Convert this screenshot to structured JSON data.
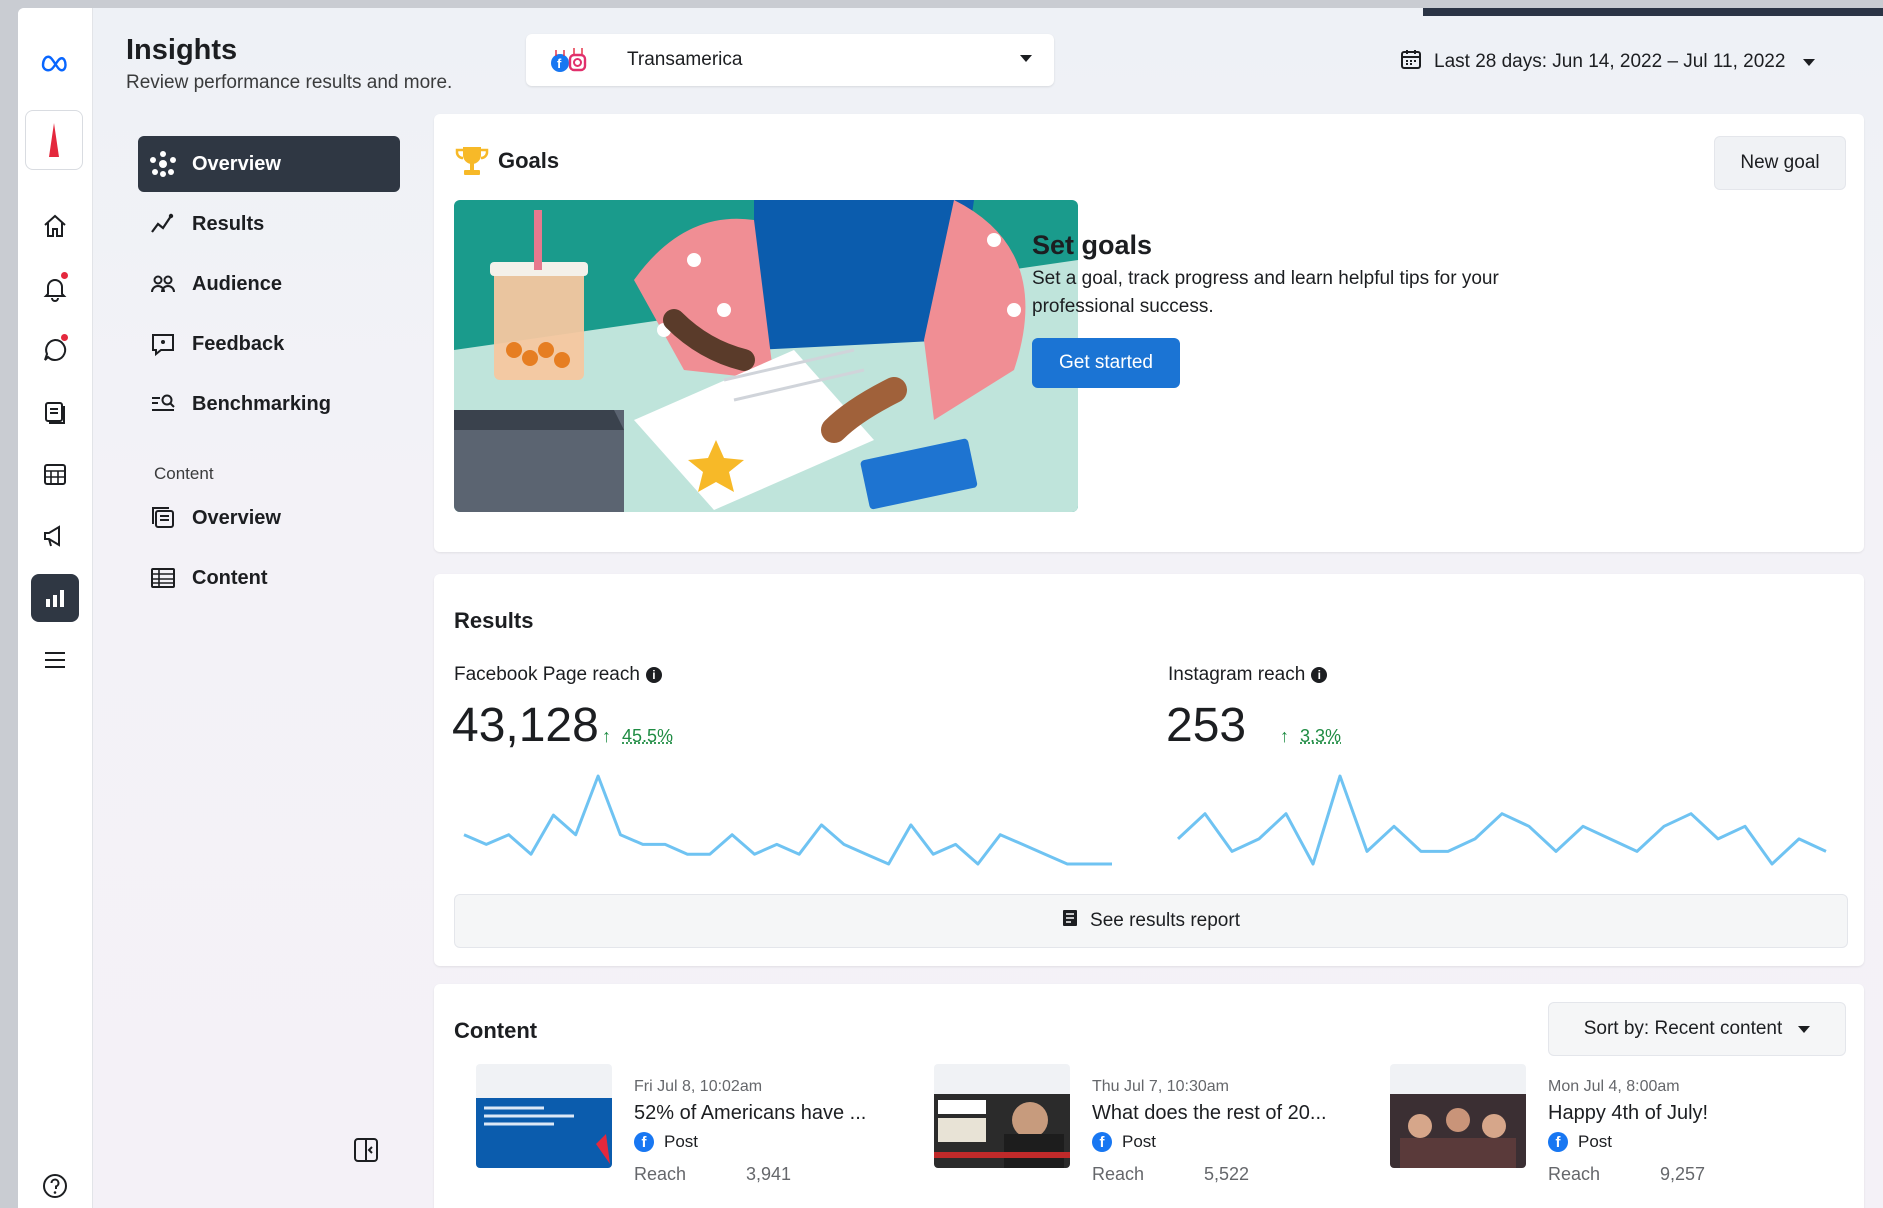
{
  "header": {
    "title": "Insights",
    "subtitle": "Review performance results and more.",
    "account_name": "Transamerica",
    "date_range": "Last 28 days: Jun 14, 2022 – Jul 11, 2022"
  },
  "nav": {
    "items": [
      {
        "label": "Overview",
        "icon": "overview-icon",
        "active": true
      },
      {
        "label": "Results",
        "icon": "results-icon"
      },
      {
        "label": "Audience",
        "icon": "audience-icon"
      },
      {
        "label": "Feedback",
        "icon": "feedback-icon"
      },
      {
        "label": "Benchmarking",
        "icon": "benchmarking-icon"
      }
    ],
    "content_heading": "Content",
    "content_items": [
      {
        "label": "Overview",
        "icon": "content-overview-icon"
      },
      {
        "label": "Content",
        "icon": "content-table-icon"
      }
    ]
  },
  "goals": {
    "title": "Goals",
    "new_goal_label": "New goal",
    "heading": "Set goals",
    "description_line1": "Set a goal, track progress and learn helpful tips for your",
    "description_line2": "professional success.",
    "cta_label": "Get started"
  },
  "results": {
    "title": "Results",
    "facebook": {
      "label": "Facebook Page reach",
      "value": "43,128",
      "delta": "45.5%",
      "sparkline": [
        4,
        3,
        4,
        2,
        6,
        4,
        10,
        4,
        3,
        3,
        2,
        2,
        4,
        2,
        3,
        2,
        5,
        3,
        2,
        1,
        5,
        2,
        3,
        1,
        4,
        3,
        2,
        1,
        1,
        1
      ]
    },
    "instagram": {
      "label": "Instagram reach",
      "value": "253",
      "delta": "3.3%",
      "sparkline": [
        3,
        5,
        2,
        3,
        5,
        1,
        8,
        2,
        4,
        2,
        2,
        3,
        5,
        4,
        2,
        4,
        3,
        2,
        4,
        5,
        3,
        4,
        1,
        3,
        2
      ]
    },
    "report_label": "See results report",
    "accent": "#6fc3f2"
  },
  "content": {
    "title": "Content",
    "sort_label": "Sort by: Recent content",
    "posts": [
      {
        "date": "Fri Jul 8, 10:02am",
        "title": "52% of Americans have ...",
        "type": "Post",
        "reach_label": "Reach",
        "reach": "3,941"
      },
      {
        "date": "Thu Jul 7, 10:30am",
        "title": "What does the rest of 20...",
        "type": "Post",
        "reach_label": "Reach",
        "reach": "5,522"
      },
      {
        "date": "Mon Jul 4, 8:00am",
        "title": "Happy 4th of July!",
        "type": "Post",
        "reach_label": "Reach",
        "reach": "9,257"
      }
    ]
  },
  "colors": {
    "primary": "#1b74d4",
    "active_nav": "#2f3743",
    "positive": "#1f8c43"
  }
}
